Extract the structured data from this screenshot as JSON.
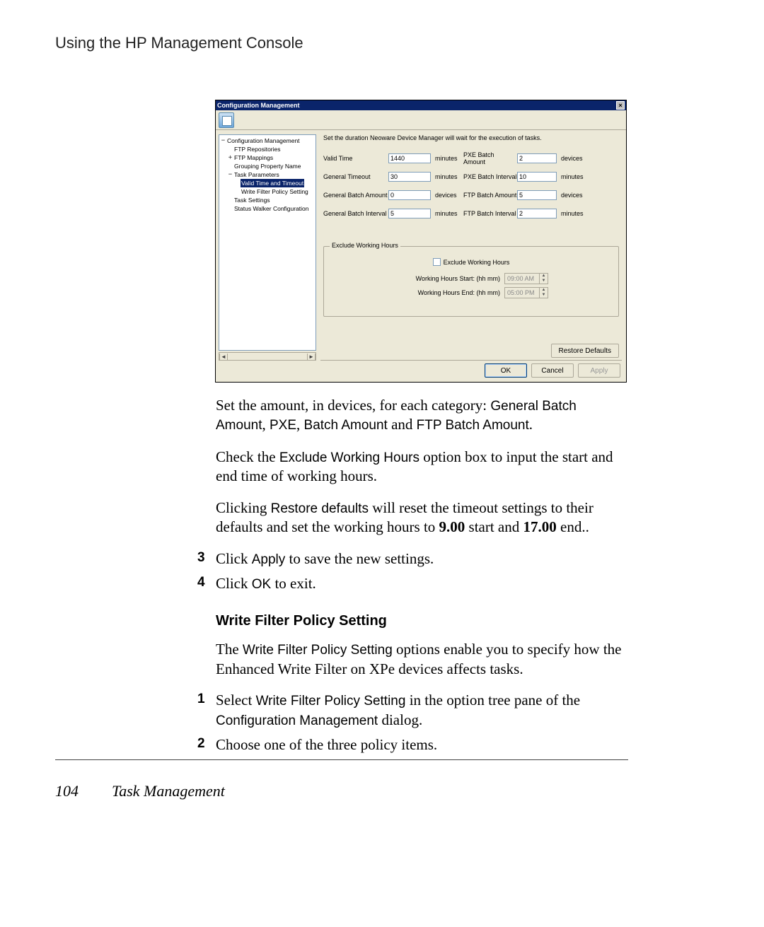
{
  "page": {
    "header": "Using the HP Management Console",
    "number": "104",
    "chapter": "Task Management"
  },
  "doc": {
    "p1_a": "Set the amount, in devices, for each category: ",
    "p1_b": "General Batch Amount",
    "p1_c": ", ",
    "p1_d": "PXE",
    "p1_e": ", ",
    "p1_f": "Batch Amount",
    "p1_g": " and ",
    "p1_h": "FTP Batch Amount",
    "p1_i": ".",
    "p2_a": "Check the ",
    "p2_b": "Exclude Working Hours",
    "p2_c": " option box to input the start and end time of working hours.",
    "p3_a": "Clicking ",
    "p3_b": "Restore defaults",
    "p3_c": " will reset the timeout settings to their defaults and set the working hours to ",
    "p3_d": "9.00",
    "p3_e": " start and ",
    "p3_f": "17.00",
    "p3_g": " end..",
    "s3_n": "3",
    "s3_a": "Click ",
    "s3_b": "Apply",
    "s3_c": " to save the new settings.",
    "s4_n": "4",
    "s4_a": "Click ",
    "s4_b": "OK",
    "s4_c": " to exit.",
    "h2": "Write Filter Policy Setting",
    "p4_a": "The ",
    "p4_b": "Write Filter Policy Setting",
    "p4_c": " options enable you to specify how the Enhanced Write Filter on XPe devices affects tasks.",
    "s1_n": "1",
    "s1_a": "Select ",
    "s1_b": "Write Filter Policy Setting",
    "s1_c": " in the option tree pane of the ",
    "s1_d": "Configuration Management",
    "s1_e": " dialog.",
    "s2_n": "2",
    "s2_t": "Choose one of the three policy items."
  },
  "dlg": {
    "title": "Configuration Management",
    "tree": {
      "root": "Configuration Management",
      "n1": "FTP Repositories",
      "n2": "FTP Mappings",
      "n3": "Grouping Property Name",
      "n4": "Task Parameters",
      "n5": "Valid Time and Timeout",
      "n6": "Write Filter Policy Setting",
      "n7": "Task Settings",
      "n8": "Status Walker Configuration"
    },
    "desc": "Set the duration Neoware Device Manager will wait for the execution of tasks.",
    "rows": [
      {
        "l": "Valid Time",
        "v": "1440",
        "u": "minutes",
        "l2": "PXE Batch Amount",
        "v2": "2",
        "u2": "devices"
      },
      {
        "l": "General Timeout",
        "v": "30",
        "u": "minutes",
        "l2": "PXE Batch Interval",
        "v2": "10",
        "u2": "minutes"
      },
      {
        "l": "General Batch Amount",
        "v": "0",
        "u": "devices",
        "l2": "FTP Batch Amount",
        "v2": "5",
        "u2": "devices"
      },
      {
        "l": "General Batch Interval",
        "v": "5",
        "u": "minutes",
        "l2": "FTP Batch Interval",
        "v2": "2",
        "u2": "minutes"
      }
    ],
    "group": {
      "legend": "Exclude Working Hours",
      "check": "Exclude Working Hours",
      "start_l": "Working Hours Start: (hh mm)",
      "start_v": "09:00 AM",
      "end_l": "Working Hours End: (hh mm)",
      "end_v": "05:00 PM"
    },
    "restore": "Restore Defaults",
    "ok": "OK",
    "cancel": "Cancel",
    "apply": "Apply"
  }
}
